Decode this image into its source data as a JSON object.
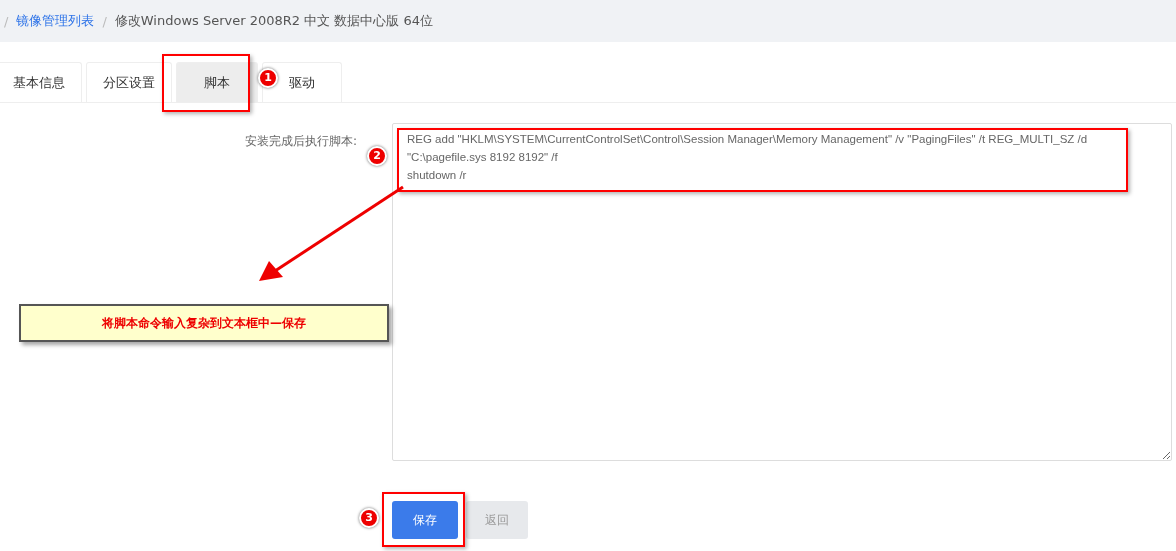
{
  "breadcrumb": {
    "separator": "/",
    "items": [
      {
        "label": "镜像管理列表",
        "kind": "link"
      },
      {
        "label": "修改Windows Server 2008R2 中文 数据中心版 64位",
        "kind": "current"
      }
    ]
  },
  "tabs": [
    {
      "label": "基本信息",
      "selected": false
    },
    {
      "label": "分区设置",
      "selected": false
    },
    {
      "label": "脚本",
      "selected": true
    },
    {
      "label": "驱动",
      "selected": false
    }
  ],
  "form": {
    "label": "安装完成后执行脚本:",
    "value": "REG add \"HKLM\\SYSTEM\\CurrentControlSet\\Control\\Session Manager\\Memory Management\" /v \"PagingFiles\" /t REG_MULTI_SZ /d \"C:\\pagefile.sys 8192 8192\" /f\nshutdown /r"
  },
  "buttons": [
    {
      "label": "保存",
      "kind": "primary"
    },
    {
      "label": "返回",
      "kind": "default"
    }
  ],
  "annotations": {
    "steps": [
      "1",
      "2",
      "3"
    ],
    "callout": "将脚本命令输入复杂到文本框中—保存"
  }
}
